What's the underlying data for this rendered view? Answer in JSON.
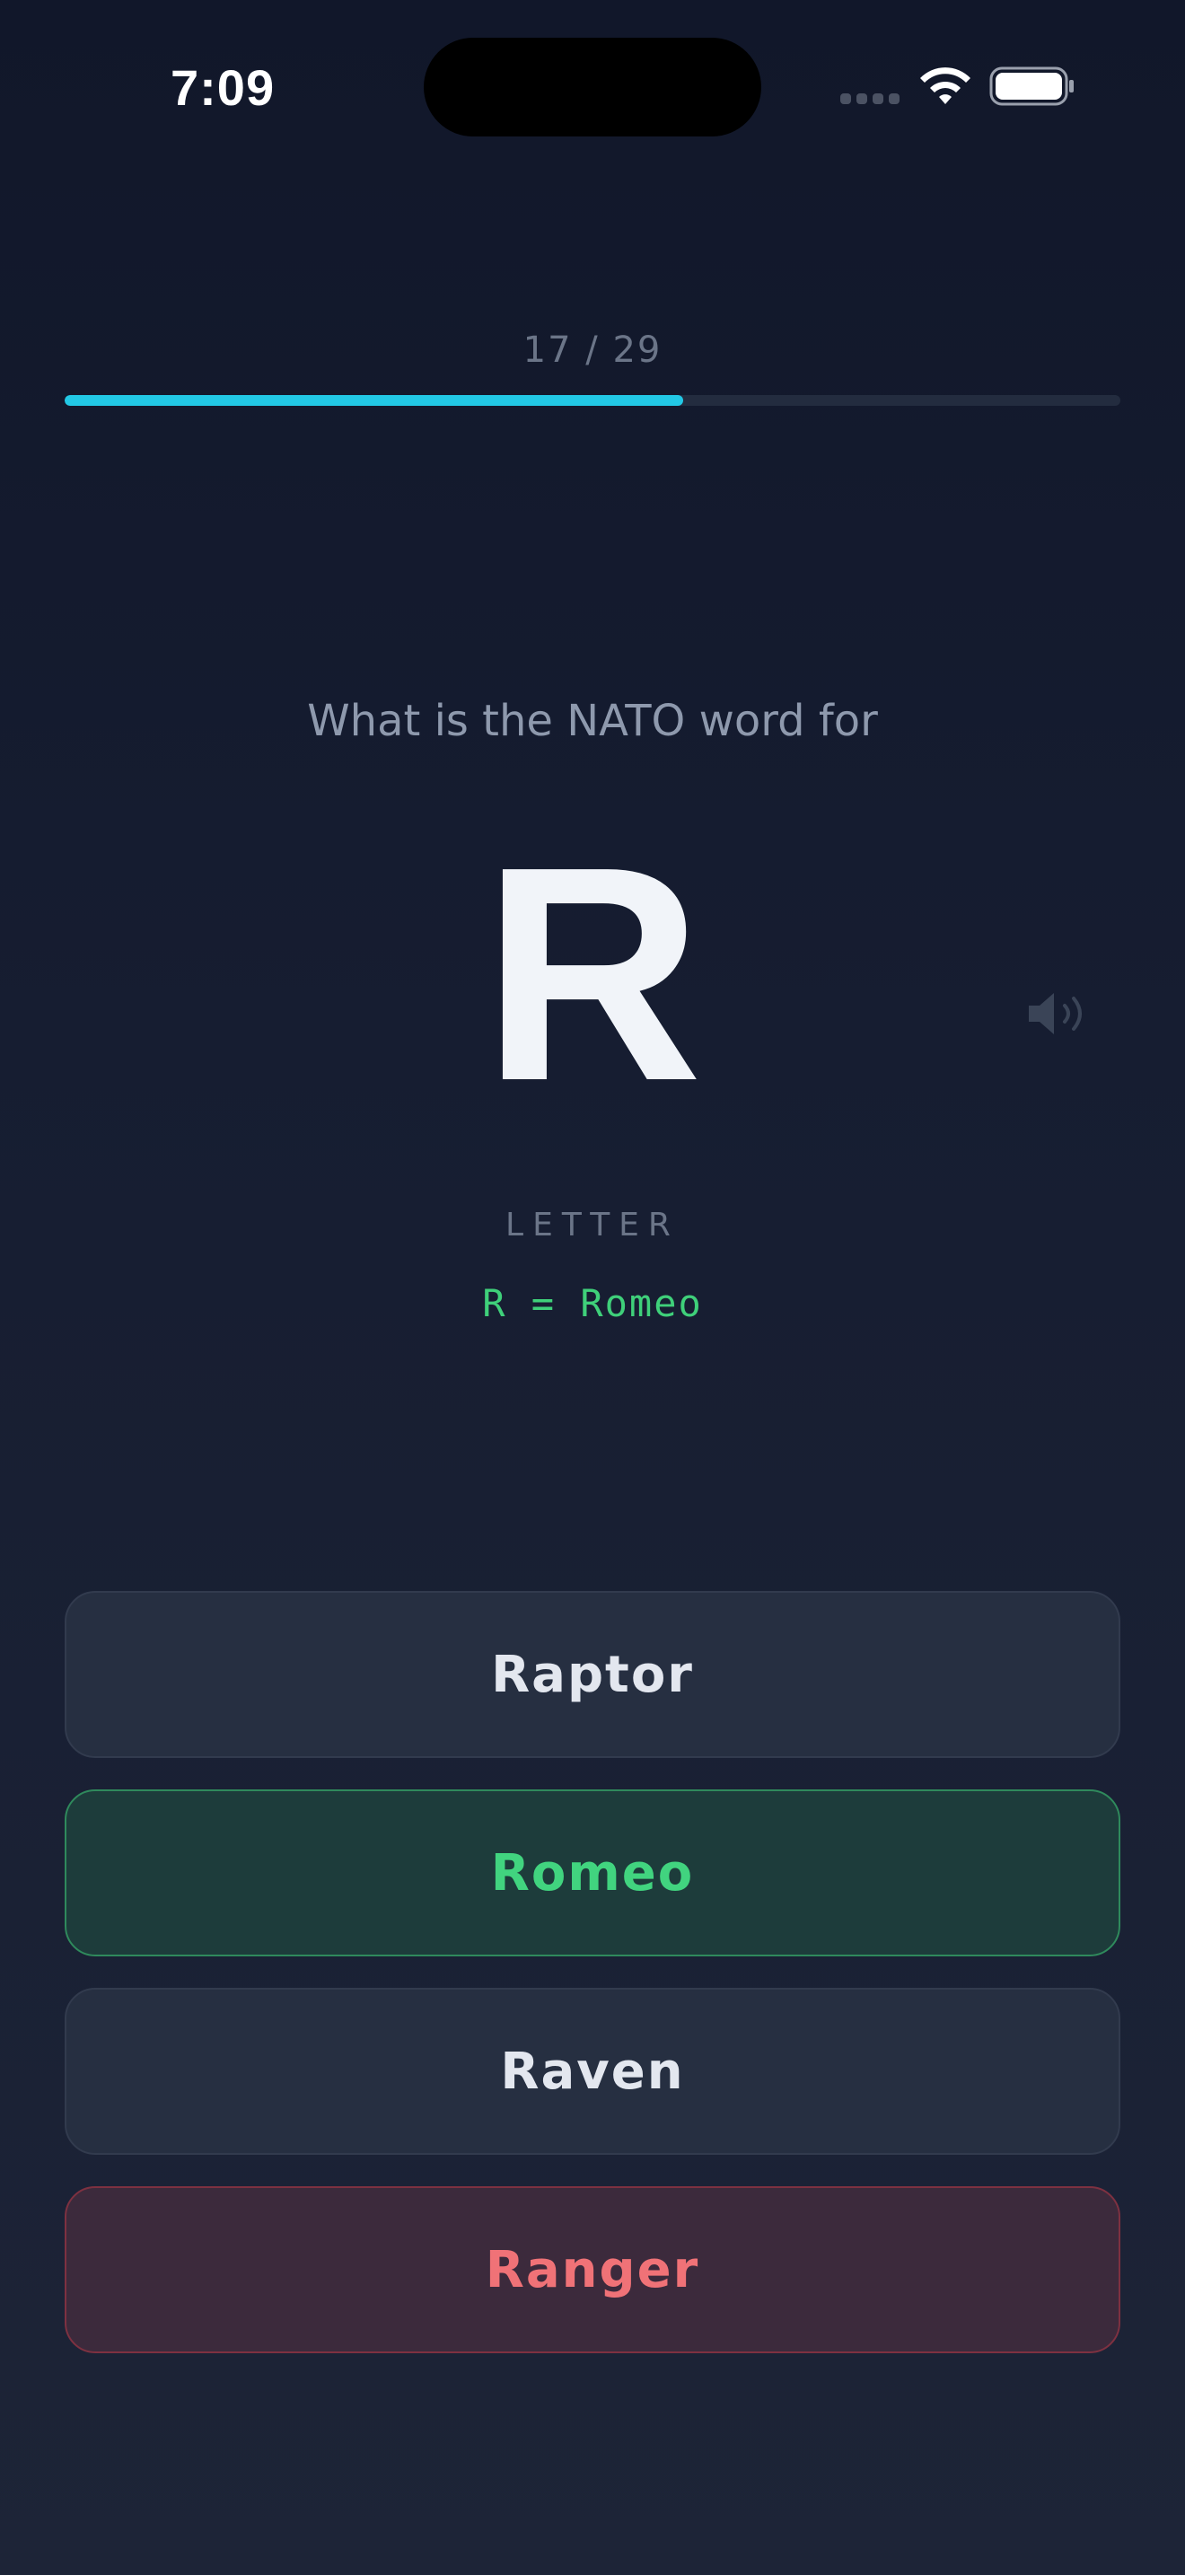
{
  "status_bar": {
    "time": "7:09",
    "icons": [
      "cellular-signal-icon",
      "wifi-icon",
      "battery-icon"
    ]
  },
  "progress": {
    "label": "17 / 29",
    "current": 17,
    "total": 29,
    "fraction": 0.586,
    "color": "#22c8e5"
  },
  "quiz": {
    "prompt": "What is the NATO word for",
    "letter": "R",
    "category": "LETTER",
    "answer_reveal": "R = Romeo",
    "speaker_icon": "speaker-icon"
  },
  "options": [
    {
      "label": "Raptor",
      "state": "neutral"
    },
    {
      "label": "Romeo",
      "state": "correct"
    },
    {
      "label": "Raven",
      "state": "neutral"
    },
    {
      "label": "Ranger",
      "state": "wrong"
    }
  ],
  "colors": {
    "background": "#141b2d",
    "correct": "#41d47f",
    "wrong": "#f07277",
    "accent": "#22c8e5"
  }
}
